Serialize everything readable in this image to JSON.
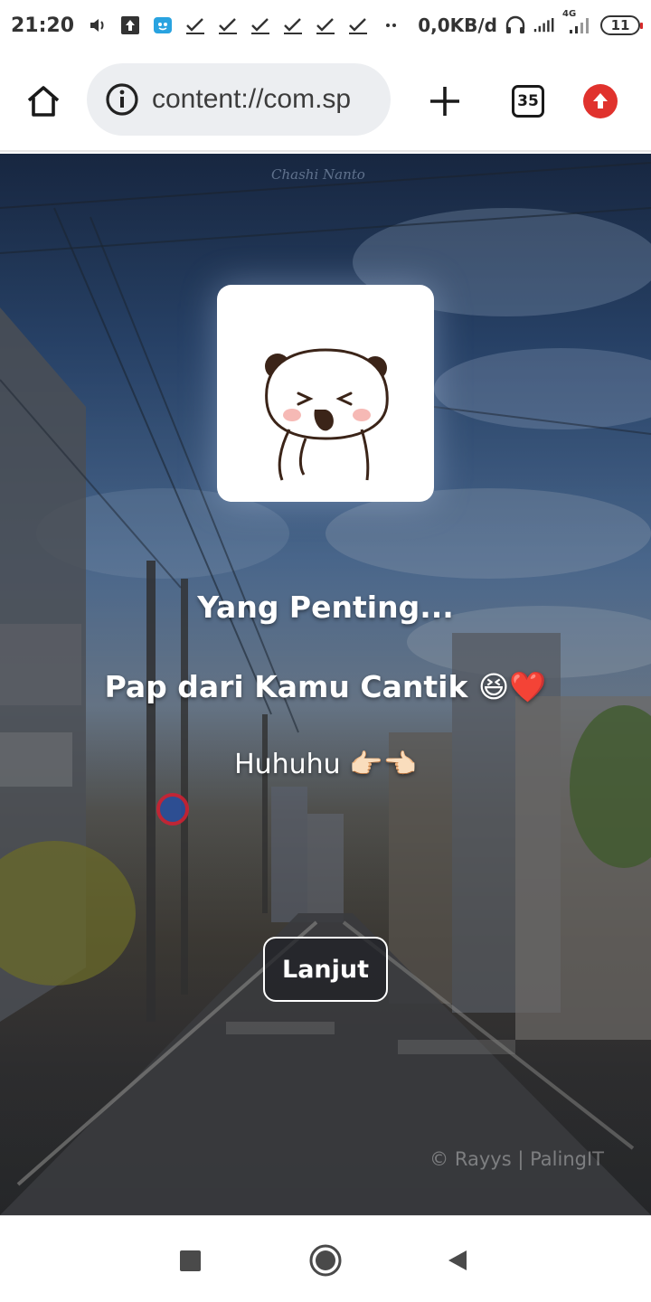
{
  "status_bar": {
    "time": "21:20",
    "network_speed": "0,0KB/d",
    "signal_label": "4G",
    "battery": "11",
    "icons": [
      "volume-icon",
      "upload-icon",
      "app-notification-icon",
      "check-icon",
      "check-icon",
      "check-icon",
      "check-icon",
      "check-icon",
      "check-icon",
      "more-dots-icon",
      "headphones-icon",
      "signal-icon",
      "signal-4g-icon",
      "battery-icon"
    ]
  },
  "browser": {
    "url": "content://com.sp",
    "tab_count": "35",
    "icons": [
      "home-icon",
      "info-icon",
      "plus-icon",
      "tabs-icon",
      "update-icon"
    ]
  },
  "page": {
    "line_1": "Yang Penting...",
    "line_2": "Pap dari Kamu Cantik 😆❤️",
    "line_3": "Huhuhu 👉🏻👈🏻",
    "button_label": "Lanjut",
    "credit": "© Rayys | PalingIT",
    "watermark": "Chashi Nanto"
  },
  "nav": {
    "icons": [
      "recent-apps-icon",
      "home-circle-icon",
      "back-icon"
    ]
  },
  "colors": {
    "accent_red": "#e0322d",
    "overlay_dark": "#1c2f4e"
  }
}
